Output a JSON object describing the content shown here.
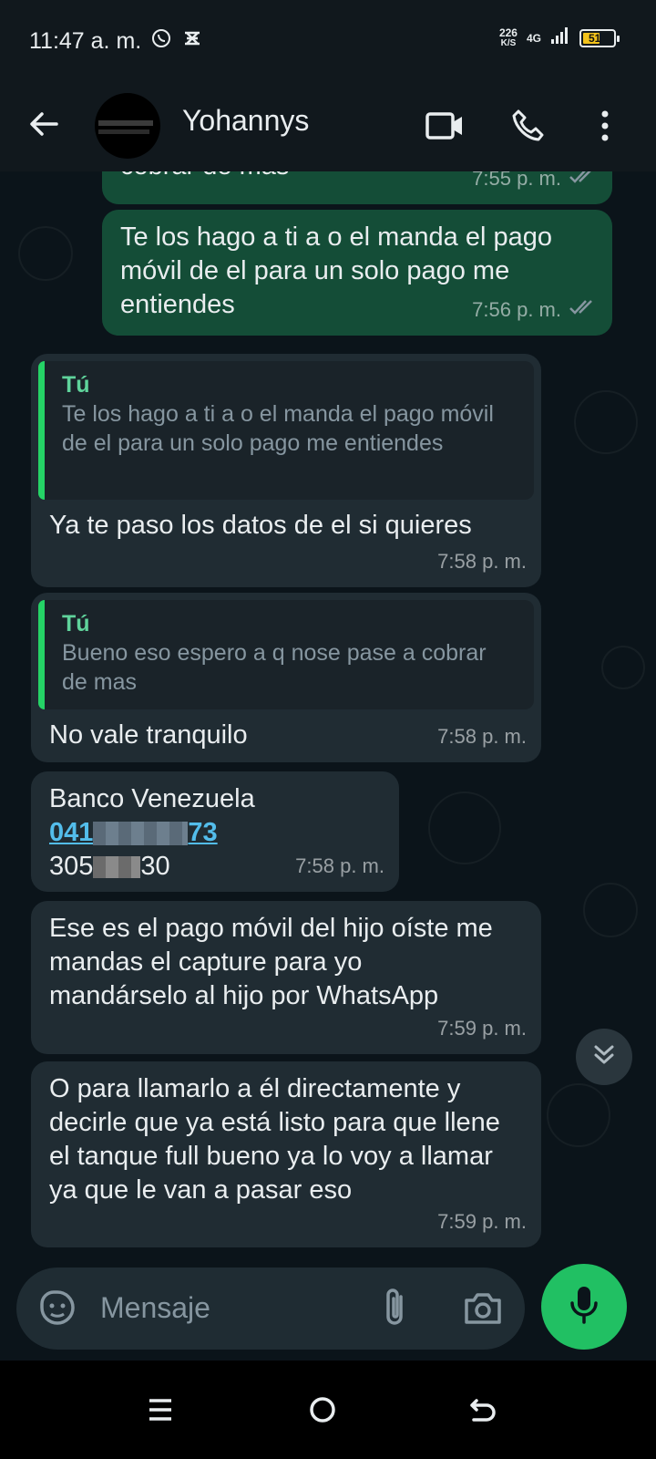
{
  "status_bar": {
    "time": "11:47 a. m.",
    "speed_value": "226",
    "speed_unit": "K/S",
    "network": "4G",
    "battery": "51",
    "icons": [
      "whatsapp-icon",
      "notification-icon",
      "signal-icon",
      "battery-icon"
    ]
  },
  "header": {
    "contact_name": "Yohannys",
    "icons": [
      "back-arrow-icon",
      "video-call-icon",
      "phone-icon",
      "more-vert-icon"
    ]
  },
  "messages": [
    {
      "direction": "out",
      "text": "cobrar de mas",
      "time": "7:55 p. m.",
      "ticks": "read"
    },
    {
      "direction": "out",
      "text": "Te los hago a ti a o el manda el pago móvil de el para un solo pago me entiendes",
      "time": "7:56 p. m.",
      "ticks": "read"
    },
    {
      "direction": "in",
      "quote_author": "Tú",
      "quote_text": "Te los hago a ti a o el manda el pago móvil de el para un solo pago me entiendes",
      "text": "Ya te paso los datos de el si quieres",
      "time": "7:58 p. m."
    },
    {
      "direction": "in",
      "quote_author": "Tú",
      "quote_text": "Bueno eso espero a q nose pase a cobrar de mas",
      "text": "No vale tranquilo",
      "time": "7:58 p. m."
    },
    {
      "direction": "in",
      "line1": "Banco Venezuela",
      "phone_start": "041",
      "phone_end": "73",
      "id_start": "305",
      "id_end": "30",
      "time": "7:58 p. m."
    },
    {
      "direction": "in",
      "text": "Ese es el pago móvil del hijo oíste me mandas el capture para yo mandárselo al hijo por WhatsApp",
      "time": "7:59 p. m."
    },
    {
      "direction": "in",
      "text": "O para llamarlo a él directamente y decirle que ya está listo para que llene el tanque full bueno ya lo voy a llamar ya que le van a pasar eso",
      "time": "7:59 p. m."
    }
  ],
  "composer": {
    "placeholder": "Mensaje",
    "icons": [
      "sticker-icon",
      "attach-icon",
      "camera-icon",
      "mic-icon"
    ]
  },
  "colors": {
    "background": "#0b141a",
    "outgoing_bubble": "#144d37",
    "incoming_bubble": "#202c33",
    "accent": "#21c063",
    "link": "#53bdeb"
  }
}
